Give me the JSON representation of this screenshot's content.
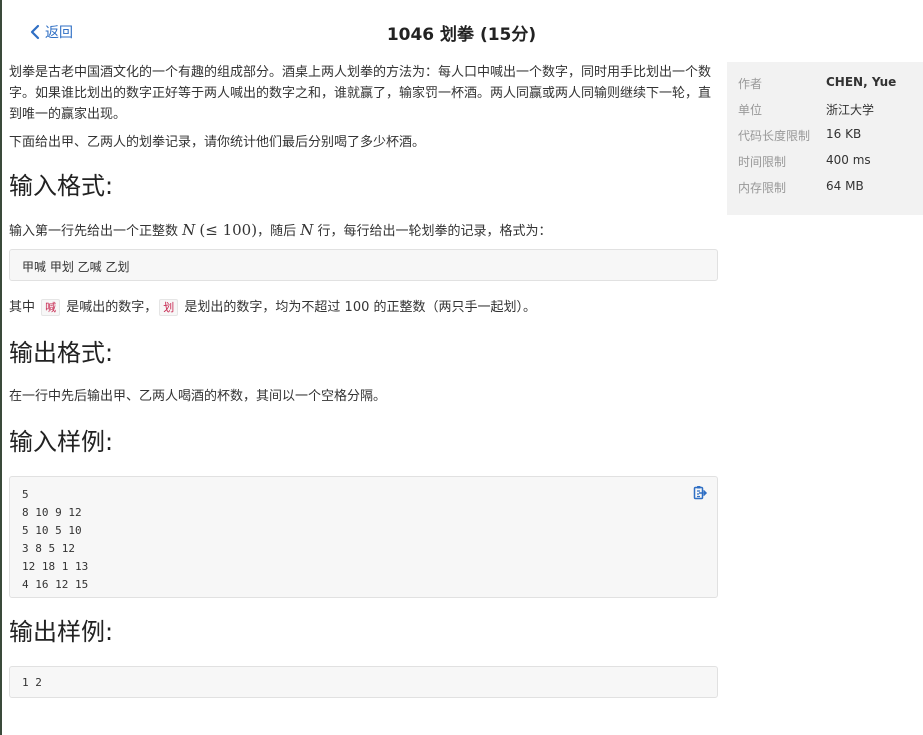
{
  "header": {
    "back_label": "返回",
    "title": "1046 划拳 (15分)"
  },
  "description": {
    "p1": "划拳是古老中国酒文化的一个有趣的组成部分。酒桌上两人划拳的方法为：每人口中喊出一个数字，同时用手比划出一个数字。如果谁比划出的数字正好等于两人喊出的数字之和，谁就赢了，输家罚一杯酒。两人同赢或两人同输则继续下一轮，直到唯一的赢家出现。",
    "p2": "下面给出甲、乙两人的划拳记录，请你统计他们最后分别喝了多少杯酒。"
  },
  "input_spec": {
    "heading": "输入格式:",
    "line1_a": "输入第一行先给出一个正整数 ",
    "N": "N",
    "le": "(≤ 100)",
    "line1_b": "，随后 ",
    "line1_c": " 行，每行给出一轮划拳的记录，格式为：",
    "format": "甲喊 甲划 乙喊 乙划",
    "line2_a": "其中 ",
    "code1": "喊",
    "line2_b": " 是喊出的数字，",
    "code2": "划",
    "line2_c": " 是划出的数字，均为不超过 100 的正整数（两只手一起划）。"
  },
  "output_spec": {
    "heading": "输出格式:",
    "text": "在一行中先后输出甲、乙两人喝酒的杯数，其间以一个空格分隔。"
  },
  "sample_input": {
    "heading": "输入样例:",
    "lines": [
      "5",
      "8 10 9 12",
      "5 10 5 10",
      "3 8 5 12",
      "12 18 1 13",
      "4 16 12 15"
    ]
  },
  "sample_output": {
    "heading": "输出样例:",
    "text": "1 2"
  },
  "sidebar": {
    "rows": [
      {
        "k": "作者",
        "v": "CHEN, Yue"
      },
      {
        "k": "单位",
        "v": "浙江大学"
      },
      {
        "k": "代码长度限制",
        "v": "16 KB"
      },
      {
        "k": "时间限制",
        "v": "400 ms"
      },
      {
        "k": "内存限制",
        "v": "64 MB"
      }
    ]
  },
  "colors": {
    "link": "#2f6fc4",
    "sidebar_bg": "#f2f2f2",
    "code_bg": "#f7f7f7"
  },
  "icons": {
    "back": "chevron-left-icon",
    "copy": "clipboard-copy-icon"
  }
}
